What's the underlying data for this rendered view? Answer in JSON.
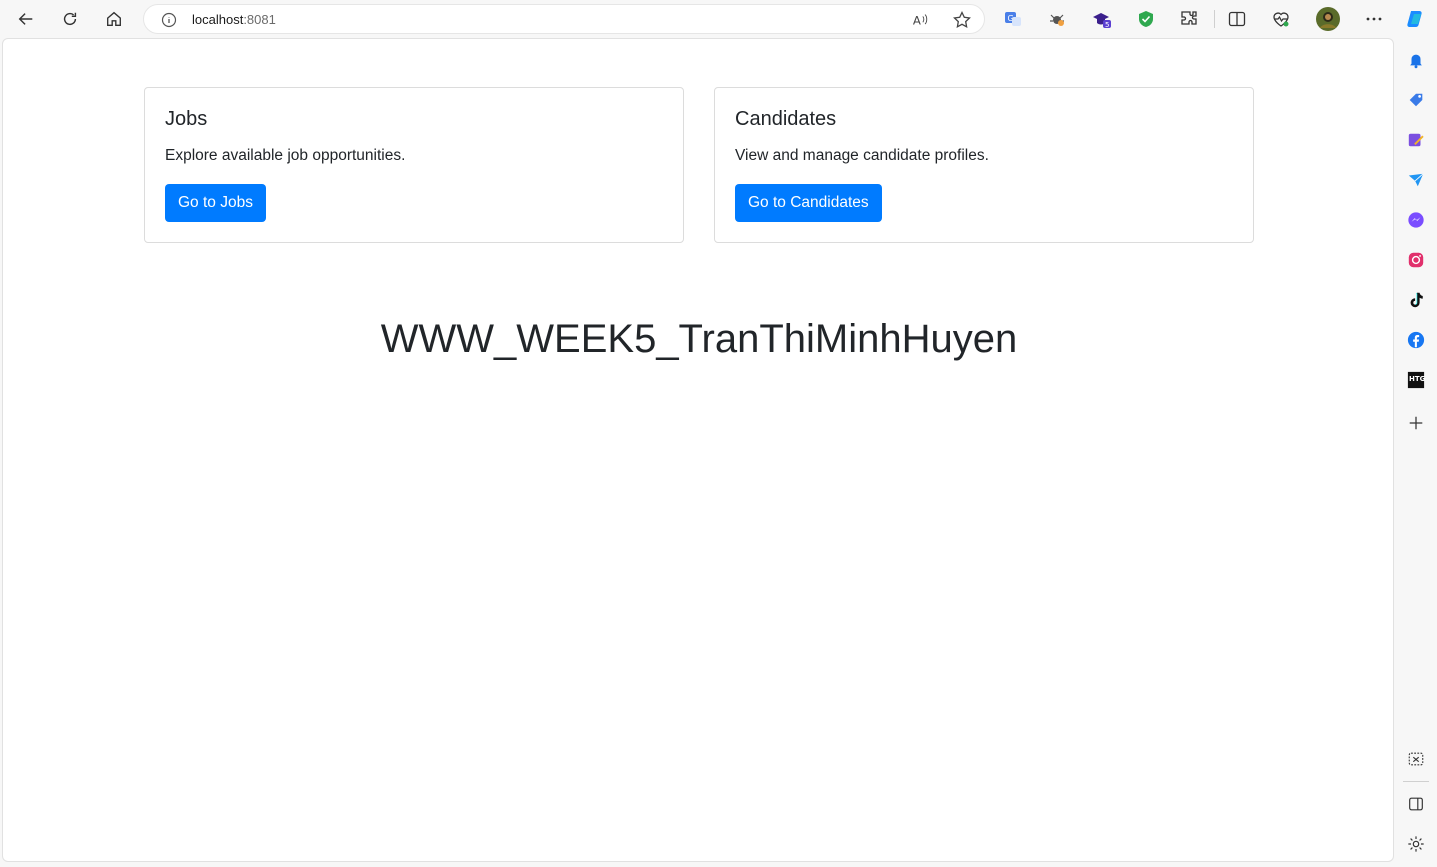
{
  "browser": {
    "url_host": "localhost",
    "url_port": ":8081"
  },
  "cards": [
    {
      "title": "Jobs",
      "text": "Explore available job opportunities.",
      "button": "Go to Jobs"
    },
    {
      "title": "Candidates",
      "text": "View and manage candidate profiles.",
      "button": "Go to Candidates"
    }
  ],
  "main": {
    "heading": "WWW_WEEK5_TranThiMinhHuyen"
  },
  "sidebar_ext": {
    "htg_label": "HTG"
  },
  "colors": {
    "primary": "#007bff",
    "text": "#212529"
  }
}
